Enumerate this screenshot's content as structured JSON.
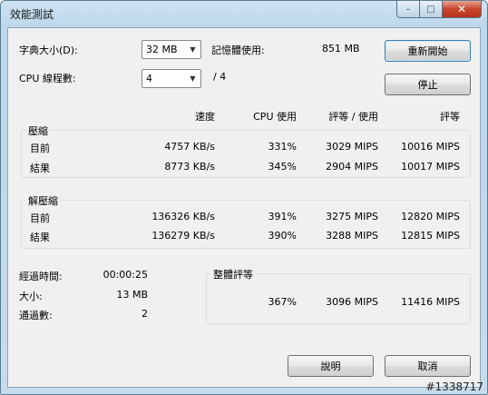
{
  "window": {
    "title": "效能測試"
  },
  "caption": {
    "min": "–",
    "max": "□",
    "close": "✕"
  },
  "settings": {
    "dict_label": "字典大小(D):",
    "dict_value": "32 MB",
    "cpu_label": "CPU 線程數:",
    "cpu_value": "4",
    "cpu_total": "/ 4",
    "mem_label": "記憶體使用:",
    "mem_value": "851 MB"
  },
  "buttons": {
    "restart": "重新開始",
    "stop": "停止",
    "help": "說明",
    "cancel": "取消"
  },
  "columns": {
    "speed": "速度",
    "cpu": "CPU 使用",
    "rating_usage": "評等 / 使用",
    "rating": "評等"
  },
  "compress": {
    "title": "壓縮",
    "rows": [
      {
        "label": "目前",
        "speed": "4757 KB/s",
        "cpu": "331%",
        "rating_usage": "3029 MIPS",
        "rating": "10016 MIPS"
      },
      {
        "label": "結果",
        "speed": "8773 KB/s",
        "cpu": "345%",
        "rating_usage": "2904 MIPS",
        "rating": "10017 MIPS"
      }
    ]
  },
  "decompress": {
    "title": "解壓縮",
    "rows": [
      {
        "label": "目前",
        "speed": "136326 KB/s",
        "cpu": "391%",
        "rating_usage": "3275 MIPS",
        "rating": "12820 MIPS"
      },
      {
        "label": "結果",
        "speed": "136279 KB/s",
        "cpu": "390%",
        "rating_usage": "3288 MIPS",
        "rating": "12815 MIPS"
      }
    ]
  },
  "stats": {
    "elapsed_label": "經過時間:",
    "elapsed_value": "00:00:25",
    "size_label": "大小:",
    "size_value": "13 MB",
    "passes_label": "通過數:",
    "passes_value": "2"
  },
  "overall": {
    "title": "整體評等",
    "cpu": "367%",
    "rating_usage": "3096 MIPS",
    "rating": "11416 MIPS"
  },
  "watermark": "#1338717"
}
